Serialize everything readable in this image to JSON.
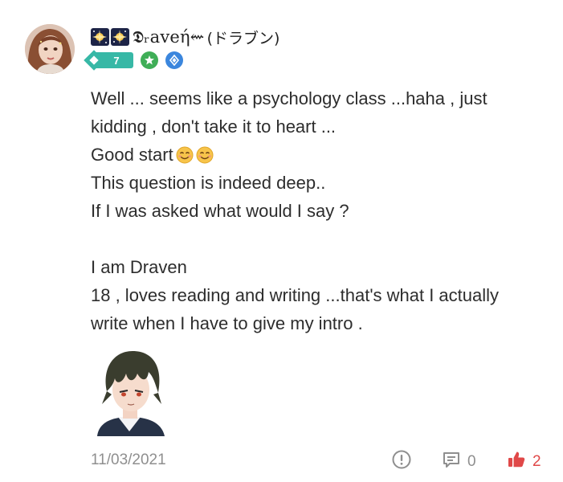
{
  "user": {
    "name": "𝕯ᵣaveή⇜",
    "name_suffix": "(ドラブン)",
    "level": "7"
  },
  "post": {
    "lines": [
      "Well ... seems like a psychology class ...haha , just",
      "kidding , don't take it to heart ...",
      "Good start",
      "This question is indeed deep..",
      "If I was asked what would I say ?",
      "",
      "I am Draven",
      "18 , loves reading and writing ...that's what I actually",
      "write when I have to give my intro ."
    ]
  },
  "footer": {
    "date": "11/03/2021",
    "comment_count": "0",
    "like_count": "2"
  },
  "colors": {
    "level_badge": "#37b8a6",
    "like_red": "#e04848",
    "muted_gray": "#8f8f8f"
  },
  "icons": [
    "avatar",
    "sparkle-decoration",
    "level-badge",
    "achievement-badge",
    "curator-badge",
    "smile-emoji",
    "anime-sticker",
    "report-icon",
    "comment-icon",
    "like-icon"
  ]
}
